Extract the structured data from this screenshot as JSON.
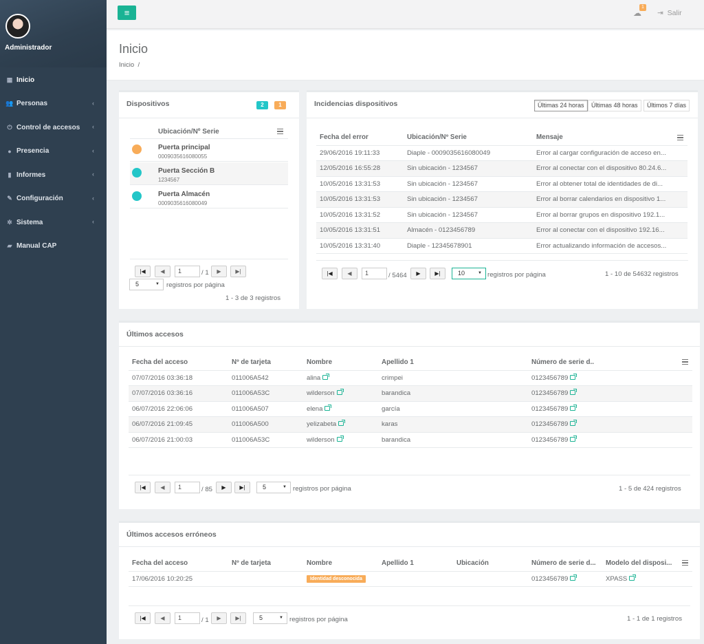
{
  "sidebar": {
    "user_name": "Administrador",
    "items": [
      {
        "label": "Inicio",
        "icon": "grid-icon"
      },
      {
        "label": "Personas",
        "icon": "users-icon"
      },
      {
        "label": "Control de accesos",
        "icon": "power-icon"
      },
      {
        "label": "Presencia",
        "icon": "user-icon"
      },
      {
        "label": "Informes",
        "icon": "file-icon"
      },
      {
        "label": "Configuración",
        "icon": "wrench-icon"
      },
      {
        "label": "Sistema",
        "icon": "gear-icon"
      },
      {
        "label": "Manual CAP",
        "icon": "book-icon"
      }
    ]
  },
  "topbar": {
    "notification_count": "1",
    "logout_label": "Salir"
  },
  "header": {
    "title": "Inicio",
    "breadcrumb": "Inicio",
    "breadcrumb_sep": "/"
  },
  "dispositivos": {
    "title": "Dispositivos",
    "badge_green": "2",
    "badge_orange": "1",
    "column": "Ubicación/Nº Serie",
    "rows": [
      {
        "name": "Puerta principal",
        "serial": "0009035616080055",
        "status_color": "#f8ac59"
      },
      {
        "name": "Puerta Sección B",
        "serial": "1234567",
        "status_color": "#23c6c8"
      },
      {
        "name": "Puerta Almacén",
        "serial": "0009035616080049",
        "status_color": "#23c6c8"
      }
    ],
    "pager": {
      "page": "1",
      "total": "/ 1",
      "per_page": "5",
      "per_page_label": "registros por página",
      "summary": "1 - 3 de 3 registros"
    }
  },
  "incidencias": {
    "title": "Incidencias dispositivos",
    "time_buttons": [
      "Últimas 24 horas",
      "Últimas 48 horas",
      "Últimos 7 días"
    ],
    "columns": [
      "Fecha del error",
      "Ubicación/Nº Serie",
      "Mensaje"
    ],
    "rows": [
      [
        "29/06/2016 19:11:33",
        "Diaple - 0009035616080049",
        "Error al cargar configuración de acceso en..."
      ],
      [
        "12/05/2016 16:55:28",
        "Sin ubicación - 1234567",
        "Error al conectar con el dispositivo 80.24.6..."
      ],
      [
        "10/05/2016 13:31:53",
        "Sin ubicación - 1234567",
        "Error al obtener total de identidades de di..."
      ],
      [
        "10/05/2016 13:31:53",
        "Sin ubicación - 1234567",
        "Error al borrar calendarios en dispositivo 1..."
      ],
      [
        "10/05/2016 13:31:52",
        "Sin ubicación - 1234567",
        "Error al borrar grupos en dispositivo 192.1..."
      ],
      [
        "10/05/2016 13:31:51",
        "Almacén - 0123456789",
        "Error al conectar con el dispositivo 192.16..."
      ],
      [
        "10/05/2016 13:31:40",
        "Diaple - 12345678901",
        "Error actualizando información de accesos..."
      ]
    ],
    "pager": {
      "page": "1",
      "total": "/ 5464",
      "per_page": "10",
      "per_page_label": "registros por página",
      "summary": "1 - 10 de 54632 registros"
    }
  },
  "accesos": {
    "title": "Últimos accesos",
    "columns": [
      "Fecha del acceso",
      "Nº de tarjeta",
      "Nombre",
      "Apellido 1",
      "Número de serie d.."
    ],
    "rows": [
      [
        "07/07/2016 03:36:18",
        "011006A542",
        "alina",
        "crimpei",
        "0123456789"
      ],
      [
        "07/07/2016 03:36:16",
        "011006A53C",
        "wilderson",
        "barandica",
        "0123456789"
      ],
      [
        "06/07/2016 22:06:06",
        "011006A507",
        "elena",
        "garcía",
        "0123456789"
      ],
      [
        "06/07/2016 21:09:45",
        "011006A500",
        "yelizabeta",
        "karas",
        "0123456789"
      ],
      [
        "06/07/2016 21:00:03",
        "011006A53C",
        "wilderson",
        "barandica",
        "0123456789"
      ]
    ],
    "pager": {
      "page": "1",
      "total": "/ 85",
      "per_page": "5",
      "per_page_label": "registros por página",
      "summary": "1 - 5 de 424 registros"
    }
  },
  "erroneos": {
    "title": "Últimos accesos erróneos",
    "columns": [
      "Fecha del acceso",
      "Nº de tarjeta",
      "Nombre",
      "Apellido 1",
      "Ubicación",
      "Número de serie d...",
      "Modelo del disposi..."
    ],
    "rows": [
      {
        "date": "17/06/2016 10:20:25",
        "card": "",
        "name_badge": "Identidad desconocida",
        "surname": "",
        "location": "",
        "serial": "0123456789",
        "model": "XPASS"
      }
    ],
    "pager": {
      "page": "1",
      "total": "/ 1",
      "per_page": "5",
      "per_page_label": "registros por página",
      "summary": "1 - 1 de 1 registros"
    }
  },
  "colors": {
    "accent": "#1ab394",
    "warning": "#f8ac59",
    "info": "#23c6c8",
    "sidebar": "#2f4050"
  }
}
